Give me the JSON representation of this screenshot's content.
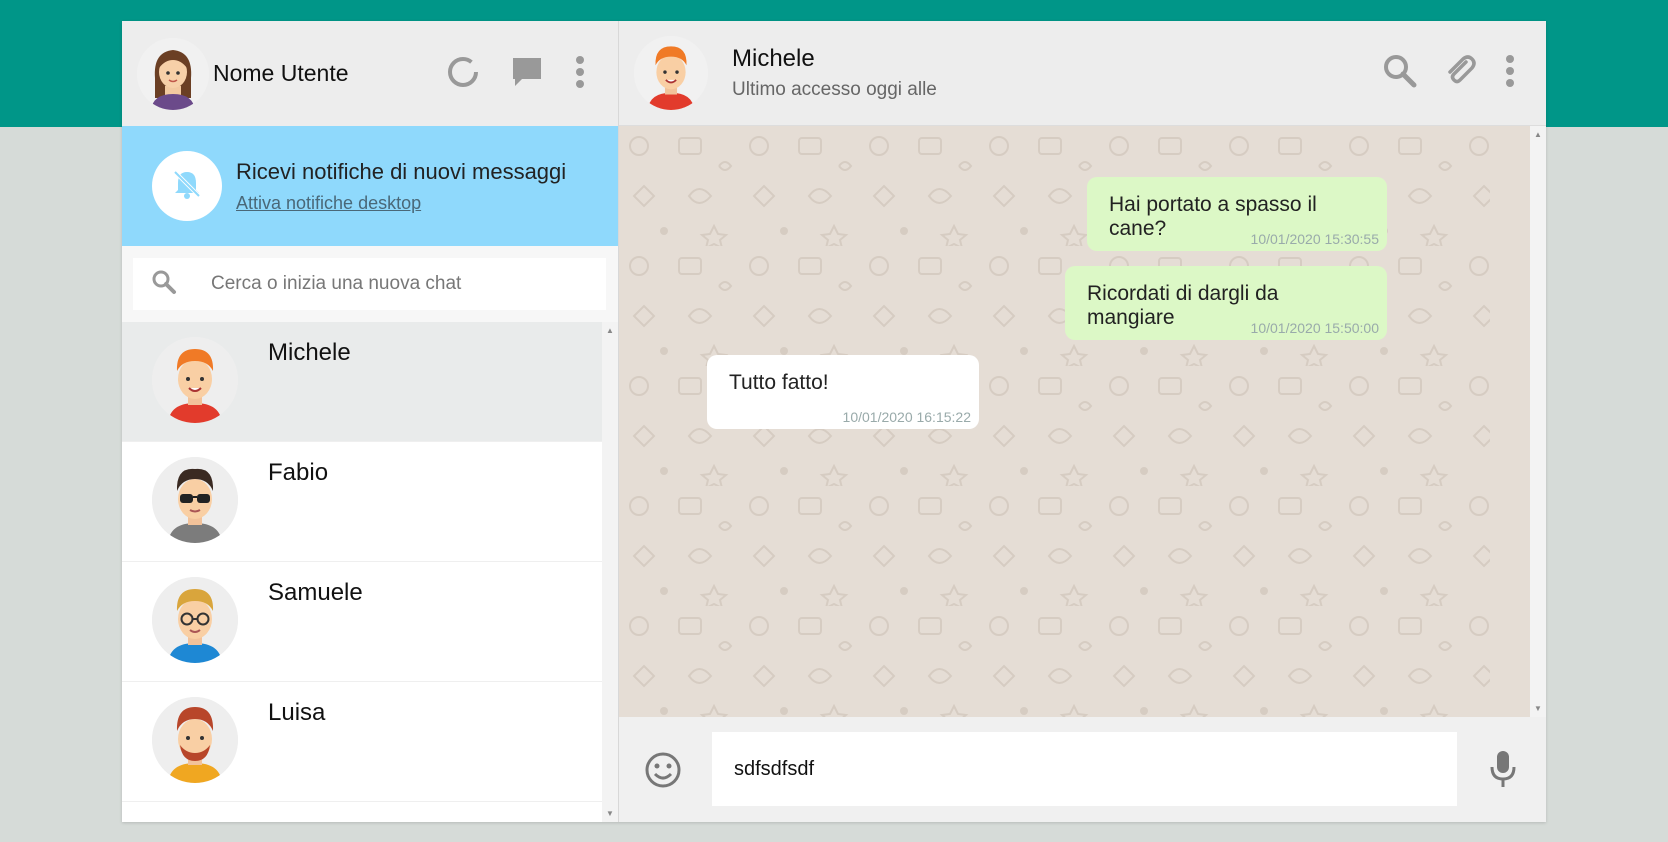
{
  "sidebar": {
    "user_name": "Nome Utente",
    "notification": {
      "title": "Ricevi notifiche di nuovi messaggi",
      "link": "Attiva notifiche desktop"
    },
    "search": {
      "placeholder": "Cerca o inizia una nuova chat"
    },
    "contacts": [
      {
        "name": "Michele",
        "active": true
      },
      {
        "name": "Fabio",
        "active": false
      },
      {
        "name": "Samuele",
        "active": false
      },
      {
        "name": "Luisa",
        "active": false
      }
    ]
  },
  "chat": {
    "name": "Michele",
    "status": "Ultimo accesso oggi alle",
    "messages": [
      {
        "type": "sent",
        "text": "Hai portato a spasso il cane?",
        "time": "10/01/2020 15:30:55"
      },
      {
        "type": "sent",
        "text": "Ricordati di dargli da mangiare",
        "time": "10/01/2020 15:50:00"
      },
      {
        "type": "received",
        "text": "Tutto fatto!",
        "time": "10/01/2020 16:15:22"
      }
    ],
    "composer_value": "sdfsdfsdf"
  },
  "colors": {
    "brand": "#009688",
    "notification_bg": "#8fd9fc",
    "sent_bubble": "#dcf8c6",
    "received_bubble": "#ffffff",
    "chat_bg": "#e5ddd5"
  },
  "icons": {
    "header_left": [
      "status-icon",
      "chat-icon",
      "menu-icon"
    ],
    "header_right": [
      "search-icon",
      "attach-icon",
      "menu-icon"
    ],
    "notification": "bell-off-icon",
    "composer": [
      "emoji-icon",
      "mic-icon"
    ]
  }
}
